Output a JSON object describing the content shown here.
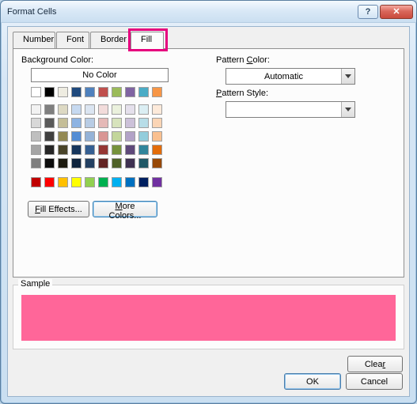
{
  "window": {
    "title": "Format Cells"
  },
  "tabs": {
    "number": "Number",
    "font": "Font",
    "border": "Border",
    "fill": "Fill",
    "active": "fill"
  },
  "fill": {
    "bg_label": "Background Color:",
    "no_color": "No Color",
    "pattern_color_label": "Pattern Color:",
    "pattern_color_value": "Automatic",
    "pattern_style_label": "Pattern Style:",
    "pattern_style_value": "",
    "fill_effects": "Fill Effects...",
    "more_colors": "More Colors..."
  },
  "sample": {
    "label": "Sample",
    "color": "#FF6699"
  },
  "buttons": {
    "clear": "Clear",
    "ok": "OK",
    "cancel": "Cancel"
  },
  "palette": {
    "auto": [
      "#FFFFFF",
      "#000000",
      "#EEECE1",
      "#1F497D",
      "#4F81BD",
      "#C0504D",
      "#9BBB59",
      "#8064A2",
      "#4BACC6",
      "#F79646"
    ],
    "theme": [
      [
        "#F2F2F2",
        "#7F7F7F",
        "#DDD9C3",
        "#C6D9F0",
        "#DBE5F1",
        "#F2DCDB",
        "#EBF1DD",
        "#E5E0EC",
        "#DBEEF3",
        "#FDEADA"
      ],
      [
        "#D8D8D8",
        "#595959",
        "#C4BD97",
        "#8DB3E2",
        "#B8CCE4",
        "#E5B9B7",
        "#D7E3BC",
        "#CCC1D9",
        "#B7DDE8",
        "#FBD5B5"
      ],
      [
        "#BFBFBF",
        "#3F3F3F",
        "#938953",
        "#548DD4",
        "#95B3D7",
        "#D99694",
        "#C3D69B",
        "#B2A2C7",
        "#92CDDC",
        "#FAC08F"
      ],
      [
        "#A5A5A5",
        "#262626",
        "#494429",
        "#17365D",
        "#366092",
        "#953734",
        "#76923C",
        "#5F497A",
        "#31859B",
        "#E36C09"
      ],
      [
        "#7F7F7F",
        "#0C0C0C",
        "#1D1B10",
        "#0F243E",
        "#244061",
        "#632423",
        "#4F6128",
        "#3F3151",
        "#205867",
        "#974806"
      ]
    ],
    "standard": [
      "#C00000",
      "#FF0000",
      "#FFC000",
      "#FFFF00",
      "#92D050",
      "#00B050",
      "#00B0F0",
      "#0070C0",
      "#002060",
      "#7030A0"
    ]
  }
}
